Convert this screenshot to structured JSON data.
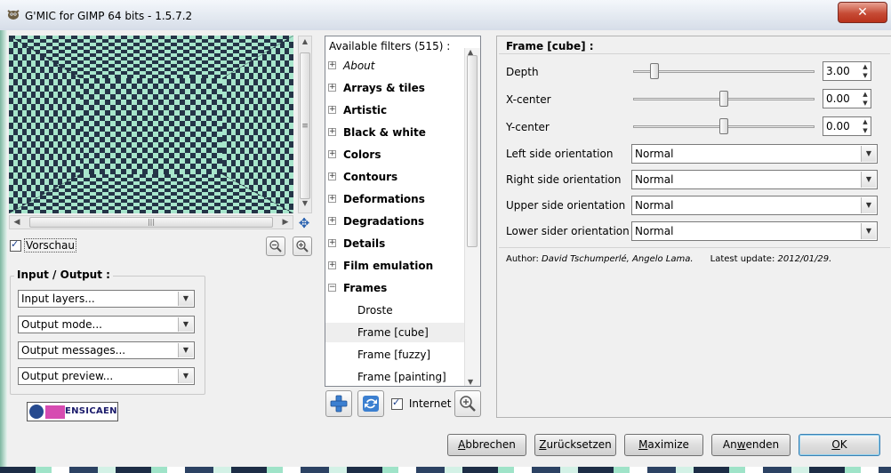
{
  "window": {
    "title": "G'MIC for GIMP 64 bits - 1.5.7.2",
    "close_glyph": "✕"
  },
  "preview": {
    "checkbox_label": "Vorschau",
    "checked": true,
    "hscroll_grip": "|||",
    "vscroll_grip": "≡"
  },
  "io": {
    "title": "Input / Output :",
    "combos": [
      "Input layers...",
      "Output mode...",
      "Output messages...",
      "Output preview..."
    ]
  },
  "filters": {
    "header": "Available filters (515) :",
    "items": [
      {
        "label": "About",
        "style": "italic",
        "expander": "+"
      },
      {
        "label": "Arrays & tiles",
        "style": "bold",
        "expander": "+"
      },
      {
        "label": "Artistic",
        "style": "bold",
        "expander": "+"
      },
      {
        "label": "Black & white",
        "style": "bold",
        "expander": "+"
      },
      {
        "label": "Colors",
        "style": "bold",
        "expander": "+"
      },
      {
        "label": "Contours",
        "style": "bold",
        "expander": "+"
      },
      {
        "label": "Deformations",
        "style": "bold",
        "expander": "+"
      },
      {
        "label": "Degradations",
        "style": "bold",
        "expander": "+"
      },
      {
        "label": "Details",
        "style": "bold",
        "expander": "+"
      },
      {
        "label": "Film emulation",
        "style": "bold",
        "expander": "+"
      },
      {
        "label": "Frames",
        "style": "bold",
        "expander": "−"
      },
      {
        "label": "Droste",
        "style": "sub"
      },
      {
        "label": "Frame [cube]",
        "style": "sub",
        "selected": true
      },
      {
        "label": "Frame [fuzzy]",
        "style": "sub"
      },
      {
        "label": "Frame [painting]",
        "style": "sub"
      }
    ],
    "internet_label": "Internet",
    "internet_checked": true
  },
  "params": {
    "title": "Frame [cube] :",
    "sliders": [
      {
        "label": "Depth",
        "value": "3.00",
        "fraction": 0.12
      },
      {
        "label": "X-center",
        "value": "0.00",
        "fraction": 0.5
      },
      {
        "label": "Y-center",
        "value": "0.00",
        "fraction": 0.5
      }
    ],
    "selects": [
      {
        "label": "Left side orientation",
        "value": "Normal"
      },
      {
        "label": "Right side orientation",
        "value": "Normal"
      },
      {
        "label": "Upper side orientation",
        "value": "Normal"
      },
      {
        "label": "Lower sider orientation",
        "value": "Normal"
      }
    ],
    "author_prefix": "Author: ",
    "author_names": "David Tschumperlé, Angelo Lama.",
    "update_prefix": "Latest update: ",
    "update_date": "2012/01/29."
  },
  "buttons": {
    "cancel": {
      "accel": "A",
      "rest": "bbrechen"
    },
    "reset": {
      "accel": "Z",
      "rest": "urücksetzen"
    },
    "maximize": {
      "accel": "M",
      "rest": "aximize"
    },
    "apply_pre": "An",
    "apply_accel": "w",
    "apply_rest": "enden",
    "ok": {
      "accel": "O",
      "rest": "K"
    }
  },
  "colors": {
    "checker_dark": "#243447",
    "checker_light": "#a8e6cc",
    "selection": "#eeeeee"
  }
}
